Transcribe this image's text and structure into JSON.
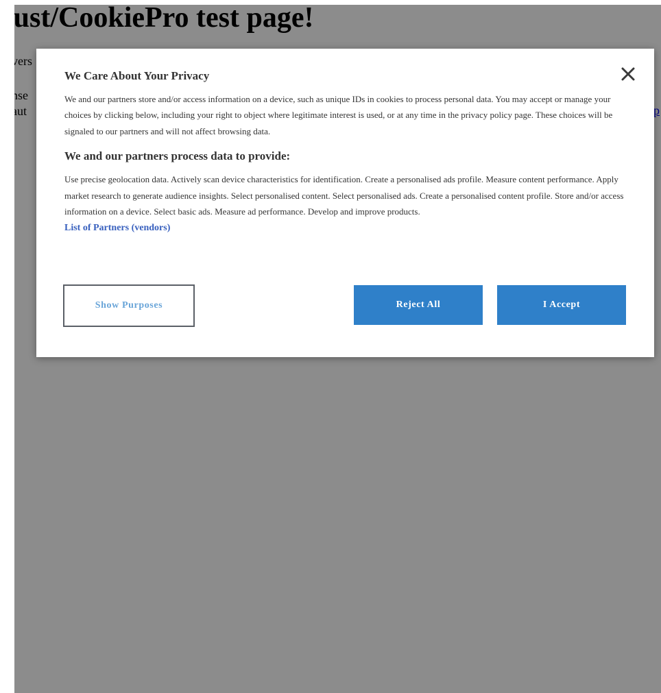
{
  "page": {
    "heading": "rust/CookiePro test page!",
    "fragments": [
      "vers",
      "nse",
      "aut"
    ],
    "link_fragment": "p"
  },
  "dialog": {
    "title": "We Care About Your Privacy",
    "close_icon": "close-icon",
    "description": "We and our partners store and/or access information on a device, such as unique IDs in cookies to process personal data. You may accept or manage your choices by clicking below, including your right to object where legitimate interest is used, or at any time in the privacy policy page. These choices will be signaled to our partners and will not affect browsing data.",
    "subtitle": "We and our partners process data to provide:",
    "purposes": "Use precise geolocation data. Actively scan device characteristics for identification. Create a personalised ads profile. Measure content performance. Apply market research to generate audience insights. Select personalised content. Select personalised ads. Create a personalised content profile. Store and/or access information on a device. Select basic ads. Measure ad performance. Develop and improve products.",
    "vendors_link": "List of Partners (vendors)",
    "buttons": {
      "show_purposes": "Show Purposes",
      "reject_all": "Reject All",
      "accept": "I Accept"
    }
  },
  "colors": {
    "primary_button": "#2f80c9",
    "secondary_text": "#68a4d8",
    "link": "#3860be",
    "overlay": "rgba(0,0,0,0.45)"
  }
}
